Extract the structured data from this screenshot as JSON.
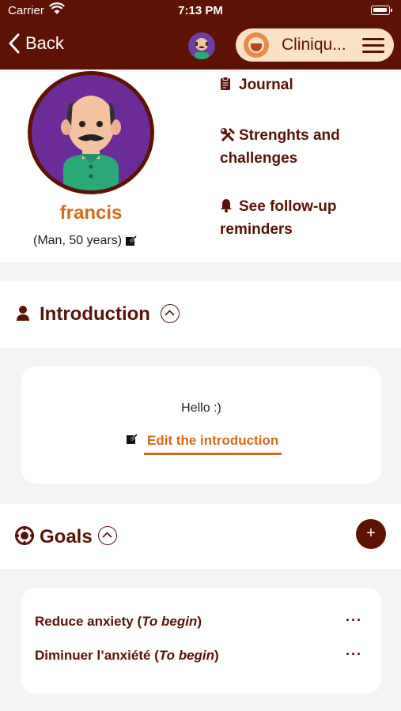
{
  "status": {
    "carrier": "Carrier",
    "time": "7:13 PM"
  },
  "nav": {
    "back_label": "Back",
    "clinic_name": "Cliniqu..."
  },
  "patient": {
    "name": "francis",
    "details": "(Man, 50 years)"
  },
  "profile_menu": [
    {
      "icon": "clipboard-icon",
      "label_line1": "Journal",
      "label_line2": ""
    },
    {
      "icon": "tools-icon",
      "label_line1": "Strenghts and",
      "label_line2": "challenges"
    },
    {
      "icon": "bell-icon",
      "label_line1": "See follow-up",
      "label_line2": "reminders"
    }
  ],
  "introduction": {
    "title": "Introduction",
    "text": "Hello :)",
    "edit_label": "Edit the introduction"
  },
  "goals": {
    "title": "Goals",
    "add_label": "+",
    "items": [
      {
        "title": "Reduce anxiety",
        "status": "To begin",
        "menu": "···"
      },
      {
        "title": "Diminuer l’anxiété",
        "status": "To begin",
        "menu": "···"
      }
    ]
  },
  "colors": {
    "brand": "#5d1204",
    "accent": "#d76a1a",
    "pill": "#fbe2c4"
  }
}
